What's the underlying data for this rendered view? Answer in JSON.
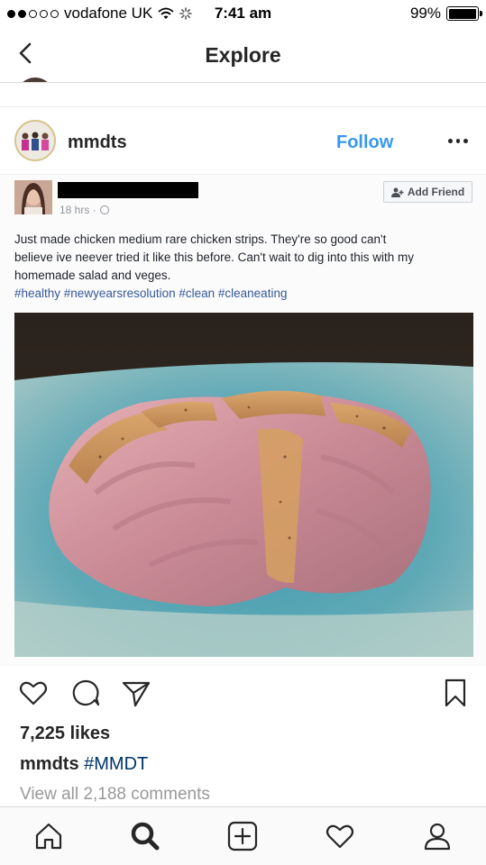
{
  "status_bar": {
    "carrier": "vodafone UK",
    "time": "7:41 am",
    "battery": "99%",
    "battery_level": 0.99,
    "signal_bars_filled": 2,
    "signal_bars_total": 5
  },
  "nav": {
    "title": "Explore",
    "back_icon": "chevron-left-icon"
  },
  "post": {
    "username": "mmdts",
    "follow_label": "Follow",
    "more_icon": "ellipsis-icon",
    "embedded_screenshot": {
      "time": "18 hrs ·",
      "add_friend_label": "Add Friend",
      "text_lines": [
        "Just made chicken medium rare chicken strips. They're so good can't",
        "believe ive neever tried it like this before. Can't wait to dig into this with my",
        "homemade salad and veges."
      ],
      "hashtags": "#healthy #newyearsresolution #clean #cleaneating"
    },
    "likes": "7,225 likes",
    "caption_user": "mmdts",
    "caption_text": "#MMDT",
    "comments_link": "View all 2,188 comments"
  },
  "actions": [
    "heart-icon",
    "comment-icon",
    "share-icon",
    "bookmark-icon"
  ],
  "tab_bar": [
    "home-icon",
    "search-icon",
    "add-post-icon",
    "activity-heart-icon",
    "profile-icon"
  ],
  "colors": {
    "follow_blue": "#3897f0",
    "hashtag_blue": "#003569",
    "fb_link_blue": "#365899",
    "muted_gray": "#999999"
  }
}
